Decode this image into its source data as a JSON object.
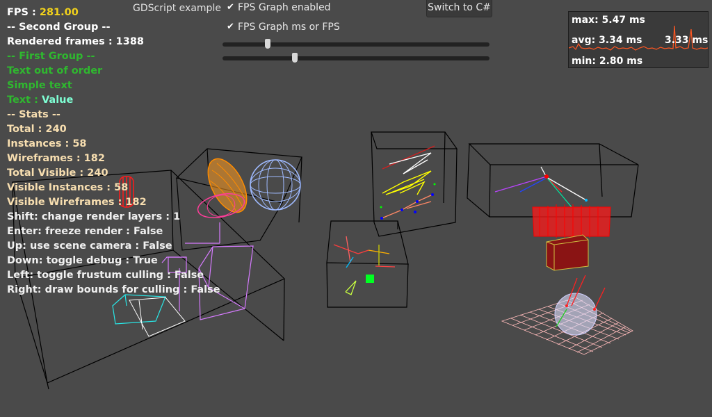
{
  "hud": {
    "fps_label": "FPS : ",
    "fps_value": "281.00",
    "second_group": "-- Second Group --",
    "rendered_frames": "Rendered frames : 1388",
    "first_group": "-- First Group --",
    "text_out_of_order": "Text out of order",
    "simple_text": "Simple text",
    "text_label": "Text : ",
    "text_value": "Value",
    "stats_header": "-- Stats --",
    "total": "Total : 240",
    "instances": "Instances : 58",
    "wireframes": "Wireframes : 182",
    "total_visible": "Total Visible : 240",
    "visible_instances": "Visible Instances : 58",
    "visible_wireframes": "Visible Wireframes : 182",
    "shift": "Shift: change render layers : 1",
    "enter": "Enter: freeze render : False",
    "up": "Up: use scene camera : False",
    "down": "Down: toggle debug : True",
    "left": "Left: toggle frustum culling : False",
    "right": "Right: draw bounds for culling : False"
  },
  "controls": {
    "example_title": "GDScript example",
    "fps_graph_enabled": "FPS Graph enabled",
    "fps_graph_ms_or_fps": "FPS Graph ms or FPS",
    "checkbox_mark": "✔",
    "slider1_value": 0.17,
    "slider2_value": 0.27,
    "switch_button": "Switch to C#"
  },
  "graph": {
    "max": "max: 5.47 ms",
    "avg": "avg: 3.34 ms",
    "current": "3.33 ms",
    "min": "min: 2.80 ms"
  },
  "colors": {
    "background": "#4a4a4a",
    "fps_value": "#f2d21b",
    "group_green": "#2fb82f",
    "value_cyan": "#7fffd4",
    "stats_peach": "#f7deb0",
    "graph_line": "#ff5722"
  }
}
